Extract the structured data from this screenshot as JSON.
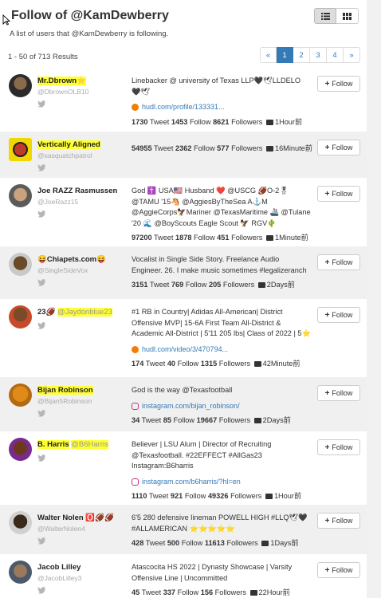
{
  "header": {
    "title": "Follow of @KamDewberry",
    "subtitle": "A list of users that @KamDewberry is following."
  },
  "summary": {
    "count_text": "1 - 50 of 713 Results"
  },
  "pagination": {
    "prev": "«",
    "pages": [
      "1",
      "2",
      "3",
      "4"
    ],
    "next": "»",
    "active": "1"
  },
  "follow_label": "Follow",
  "users": [
    {
      "name": "Mr.Dbrown⭐",
      "handle": "@DbrownOLB10",
      "bio": "Linebacker @ university of Texas LLP🖤🕊LLDELO 🖤🕊",
      "link": "hudl.com/profile/133331...",
      "link_type": "hudl",
      "tweets": "1730",
      "follows": "1453",
      "followers": "8621",
      "ago": "1Hour前"
    },
    {
      "name": "Vertically Aligned",
      "handle": "@sasquatchpatrol",
      "bio": "",
      "link": "",
      "link_type": "",
      "tweets": "54955",
      "follows": "2362",
      "followers": "577",
      "ago": "16Minute前"
    },
    {
      "name": "Joe RAZZ Rasmussen",
      "handle": "@JoeRazz15",
      "bio": "God ✝️ USA🇺🇸 Husband ❤️ @USCG 🏈O-2🎖 @TAMU '15🐴 @AggiesByTheSea A⚓M @AggieCorps🦅Mariner @TexasMaritime 🚢 @Tulane '20 🌊 @BoyScouts Eagle Scout 🦅 RGV🌵",
      "link": "",
      "link_type": "",
      "tweets": "97200",
      "follows": "1878",
      "followers": "451",
      "ago": "1Minute前"
    },
    {
      "name": "😝Chiapets.com😝",
      "handle": "@SingleSideVox",
      "bio": "Vocalist in Single Side Story. Freelance Audio Engineer. 26. I make music sometimes #legalizeranch",
      "link": "",
      "link_type": "",
      "tweets": "3151",
      "follows": "769",
      "followers": "205",
      "ago": "2Days前"
    },
    {
      "name": "23🏈",
      "inline_handle": "@Jaydonblue23",
      "handle": "",
      "bio": "#1 RB in Country| Adidas All-American| District Offensive MVP| 15-6A First Team All-District & Academic All-District | 5'11 205 lbs| Class of 2022 | 5⭐",
      "link": "hudl.com/video/3/470794...",
      "link_type": "hudl",
      "tweets": "174",
      "follows": "40",
      "followers": "1315",
      "ago": "42Minute前"
    },
    {
      "name": "Bijan Robinson",
      "handle": "@Bijan5Robinson",
      "bio": "God is the way @Texasfootball",
      "link": "instagram.com/bijan_robinson/",
      "link_type": "ig",
      "tweets": "34",
      "follows": "85",
      "followers": "19667",
      "ago": "2Days前"
    },
    {
      "name": "B. Harris",
      "inline_handle": "@B6Harris",
      "handle": "",
      "bio": "Believer | LSU Alum | Director of Recruiting @Texasfootball. #22EFFECT #AllGas23 Instagram:B6harris",
      "link": "instagram.com/b6harris/?hl=en",
      "link_type": "ig",
      "tweets": "1110",
      "follows": "921",
      "followers": "49326",
      "ago": "1Hour前"
    },
    {
      "name": "Walter Nolen 🅾️🏈🏈",
      "handle": "@WalterNolen4",
      "bio": "6'5 280 defensive lineman POWELL HIGH #LLQ🕊🖤 #ALLAMERICAN ⭐⭐⭐⭐⭐",
      "link": "",
      "link_type": "",
      "tweets": "428",
      "follows": "500",
      "followers": "11613",
      "ago": "1Days前"
    },
    {
      "name": "Jacob Lilley",
      "handle": "@JacobLilley3",
      "bio": "Atascocita HS 2022 | Dynasty Showcase | Varsity Offensive Line | Uncommitted",
      "link": "",
      "link_type": "",
      "tweets": "45",
      "follows": "337",
      "followers": "156",
      "ago": "22Hour前"
    }
  ],
  "stat_words": {
    "tweet": "Tweet",
    "follow": "Follow",
    "followers": "Followers"
  }
}
